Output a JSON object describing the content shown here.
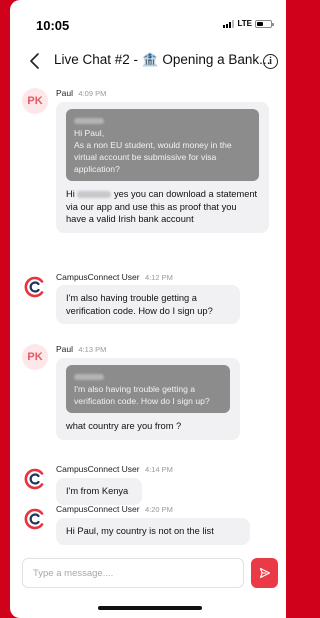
{
  "status_bar": {
    "time": "10:05",
    "network": "LTE",
    "battery_level": 0.45
  },
  "header": {
    "title": "Live Chat #2 - 🏦 Opening a Bank...",
    "back_icon": "chevron-left-icon",
    "info_icon": "info-icon",
    "info_glyph": "i"
  },
  "messages": [
    {
      "sender": "Paul",
      "avatar_initials": "PK",
      "time": "4:09 PM",
      "quote_lines": [
        "Hi Paul,",
        "As a non EU student, would money in the virtual account be submissive for visa application?"
      ],
      "text_before": "Hi",
      "text_after": "yes you can download a statement via our app and use this as proof that you have a valid Irish bank account"
    },
    {
      "sender": "CampusConnect User",
      "time": "4:12 PM",
      "text": "I'm also having trouble getting a verification code. How do I sign up?"
    },
    {
      "sender": "Paul",
      "avatar_initials": "PK",
      "time": "4:13 PM",
      "quote_text": "I'm also having trouble getting a verification code. How do I sign up?",
      "text": "what country are you from ?"
    },
    {
      "sender": "CampusConnect User",
      "time": "4:14 PM",
      "text": "I'm from Kenya"
    },
    {
      "sender": "CampusConnect User",
      "time": "4:20 PM",
      "text": "Hi Paul, my country is not on the list"
    }
  ],
  "composer": {
    "placeholder": "Type a message....",
    "send_icon": "send-icon"
  },
  "colors": {
    "accent": "#ea3a46",
    "frame": "#d0021b",
    "bubble": "#f1f1f4",
    "quote": "#8c8c8c"
  }
}
